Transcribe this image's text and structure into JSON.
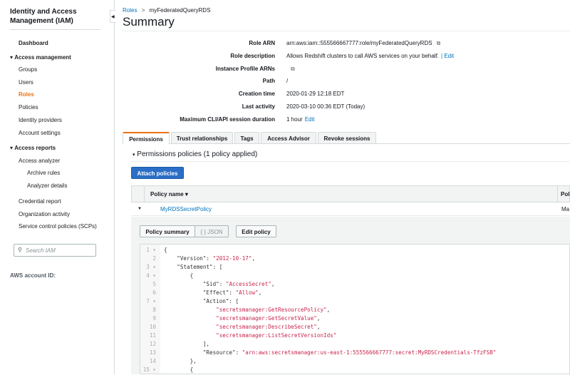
{
  "sidebar": {
    "title": "Identity and Access Management (IAM)",
    "dashboard": "Dashboard",
    "access_management": "Access management",
    "am_items": [
      "Groups",
      "Users",
      "Roles",
      "Policies",
      "Identity providers",
      "Account settings"
    ],
    "active_item": "Roles",
    "access_reports": "Access reports",
    "ar_items": [
      "Access analyzer",
      "Archive rules",
      "Analyzer details",
      "Credential report",
      "Organization activity",
      "Service control policies (SCPs)"
    ],
    "search_placeholder": "Search IAM",
    "account_id_label": "AWS account ID:"
  },
  "breadcrumb": {
    "parent": "Roles",
    "separator": ">",
    "current": "myFederatedQueryRDS"
  },
  "page_title": "Summary",
  "summary": [
    {
      "label": "Role ARN",
      "value": "arn:aws:iam::555566667777:role/myFederatedQueryRDS",
      "icon": "copy-icon"
    },
    {
      "label": "Role description",
      "value": "Allows Redshift clusters to call AWS services on your behalf.",
      "link": "| Edit"
    },
    {
      "label": "Instance Profile ARNs",
      "value": "",
      "icon": "copy-icon"
    },
    {
      "label": "Path",
      "value": "/"
    },
    {
      "label": "Creation time",
      "value": "2020-01-29 12:18 EDT"
    },
    {
      "label": "Last activity",
      "value": "2020-03-10 00:36 EDT (Today)"
    },
    {
      "label": "Maximum CLI/API session duration",
      "value": "1 hour",
      "link": "Edit"
    }
  ],
  "tabs": [
    "Permissions",
    "Trust relationships",
    "Tags",
    "Access Advisor",
    "Revoke sessions"
  ],
  "active_tab": "Permissions",
  "permissions": {
    "heading": "Permissions policies (1 policy applied)",
    "attach_button": "Attach policies",
    "columns": [
      "Policy name ▾",
      "Pol"
    ],
    "rows": [
      {
        "name": "MyRDSSecretPolicy",
        "type": "Ma"
      }
    ],
    "policy_buttons": {
      "summary": "Policy summary",
      "json": "{ } JSON",
      "edit": "Edit policy"
    }
  },
  "code_lines": [
    {
      "n": "1 ▾",
      "p": [
        [
          "{",
          ""
        ]
      ]
    },
    {
      "n": "2",
      "p": [
        [
          "    \"Version\": ",
          ""
        ],
        [
          "\"2012-10-17\"",
          "s"
        ],
        [
          ",",
          ""
        ]
      ]
    },
    {
      "n": "3 ▾",
      "p": [
        [
          "    \"Statement\": [",
          ""
        ]
      ]
    },
    {
      "n": "4 ▾",
      "p": [
        [
          "        {",
          ""
        ]
      ]
    },
    {
      "n": "5",
      "p": [
        [
          "            \"Sid\": ",
          ""
        ],
        [
          "\"AccessSecret\"",
          "s"
        ],
        [
          ",",
          ""
        ]
      ]
    },
    {
      "n": "6",
      "p": [
        [
          "            \"Effect\": ",
          ""
        ],
        [
          "\"Allow\"",
          "s"
        ],
        [
          ",",
          ""
        ]
      ]
    },
    {
      "n": "7 ▾",
      "p": [
        [
          "            \"Action\": [",
          ""
        ]
      ]
    },
    {
      "n": "8",
      "p": [
        [
          "                ",
          ""
        ],
        [
          "\"secretsmanager:GetResourcePolicy\"",
          "s"
        ],
        [
          ",",
          ""
        ]
      ]
    },
    {
      "n": "9",
      "p": [
        [
          "                ",
          ""
        ],
        [
          "\"secretsmanager:GetSecretValue\"",
          "s"
        ],
        [
          ",",
          ""
        ]
      ]
    },
    {
      "n": "10",
      "p": [
        [
          "                ",
          ""
        ],
        [
          "\"secretsmanager:DescribeSecret\"",
          "s"
        ],
        [
          ",",
          ""
        ]
      ]
    },
    {
      "n": "11",
      "p": [
        [
          "                ",
          ""
        ],
        [
          "\"secretsmanager:ListSecretVersionIds\"",
          "s"
        ]
      ]
    },
    {
      "n": "12",
      "p": [
        [
          "            ],",
          ""
        ]
      ]
    },
    {
      "n": "13",
      "p": [
        [
          "            \"Resource\": ",
          ""
        ],
        [
          "\"arn:aws:secretsmanager:us-east-1:555566667777:secret:MyRDSCredentials-TfzFSB\"",
          "s"
        ]
      ]
    },
    {
      "n": "14",
      "p": [
        [
          "        },",
          ""
        ]
      ]
    },
    {
      "n": "15 ▾",
      "p": [
        [
          "        {",
          ""
        ]
      ]
    }
  ]
}
